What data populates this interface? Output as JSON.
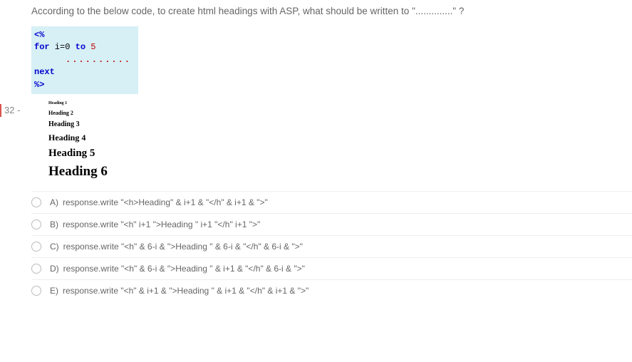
{
  "question_number": "32 -",
  "question_text": "According to the below code, to create html headings with ASP, what should be written to \"..............\" ?",
  "code": {
    "open": "<%",
    "line": {
      "kw1": "for",
      "ident": " i=0 ",
      "kw2": "to",
      "num": " 5"
    },
    "dots": "..........",
    "next": "next",
    "close": "%>"
  },
  "headings": [
    {
      "cls": "h1",
      "text": "Heading 1"
    },
    {
      "cls": "h2",
      "text": "Heading 2"
    },
    {
      "cls": "h3",
      "text": "Heading 3"
    },
    {
      "cls": "h4",
      "text": "Heading 4"
    },
    {
      "cls": "h5",
      "text": "Heading 5"
    },
    {
      "cls": "h6",
      "text": "Heading 6"
    }
  ],
  "options": [
    {
      "letter": "A)",
      "text": "response.write \"<h>Heading\" & i+1 & \"</h\" & i+1 & \">\""
    },
    {
      "letter": "B)",
      "text": "response.write \"<h\" i+1 \">Heading \" i+1 \"</h\" i+1 \">\""
    },
    {
      "letter": "C)",
      "text": "response.write \"<h\" & 6-i & \">Heading \" & 6-i & \"</h\" & 6-i & \">\""
    },
    {
      "letter": "D)",
      "text": "response.write \"<h\" & 6-i & \">Heading \" & i+1 & \"</h\" & 6-i & \">\""
    },
    {
      "letter": "E)",
      "text": "response.write \"<h\" & i+1 & \">Heading \" & i+1 & \"</h\" & i+1 & \">\""
    }
  ]
}
